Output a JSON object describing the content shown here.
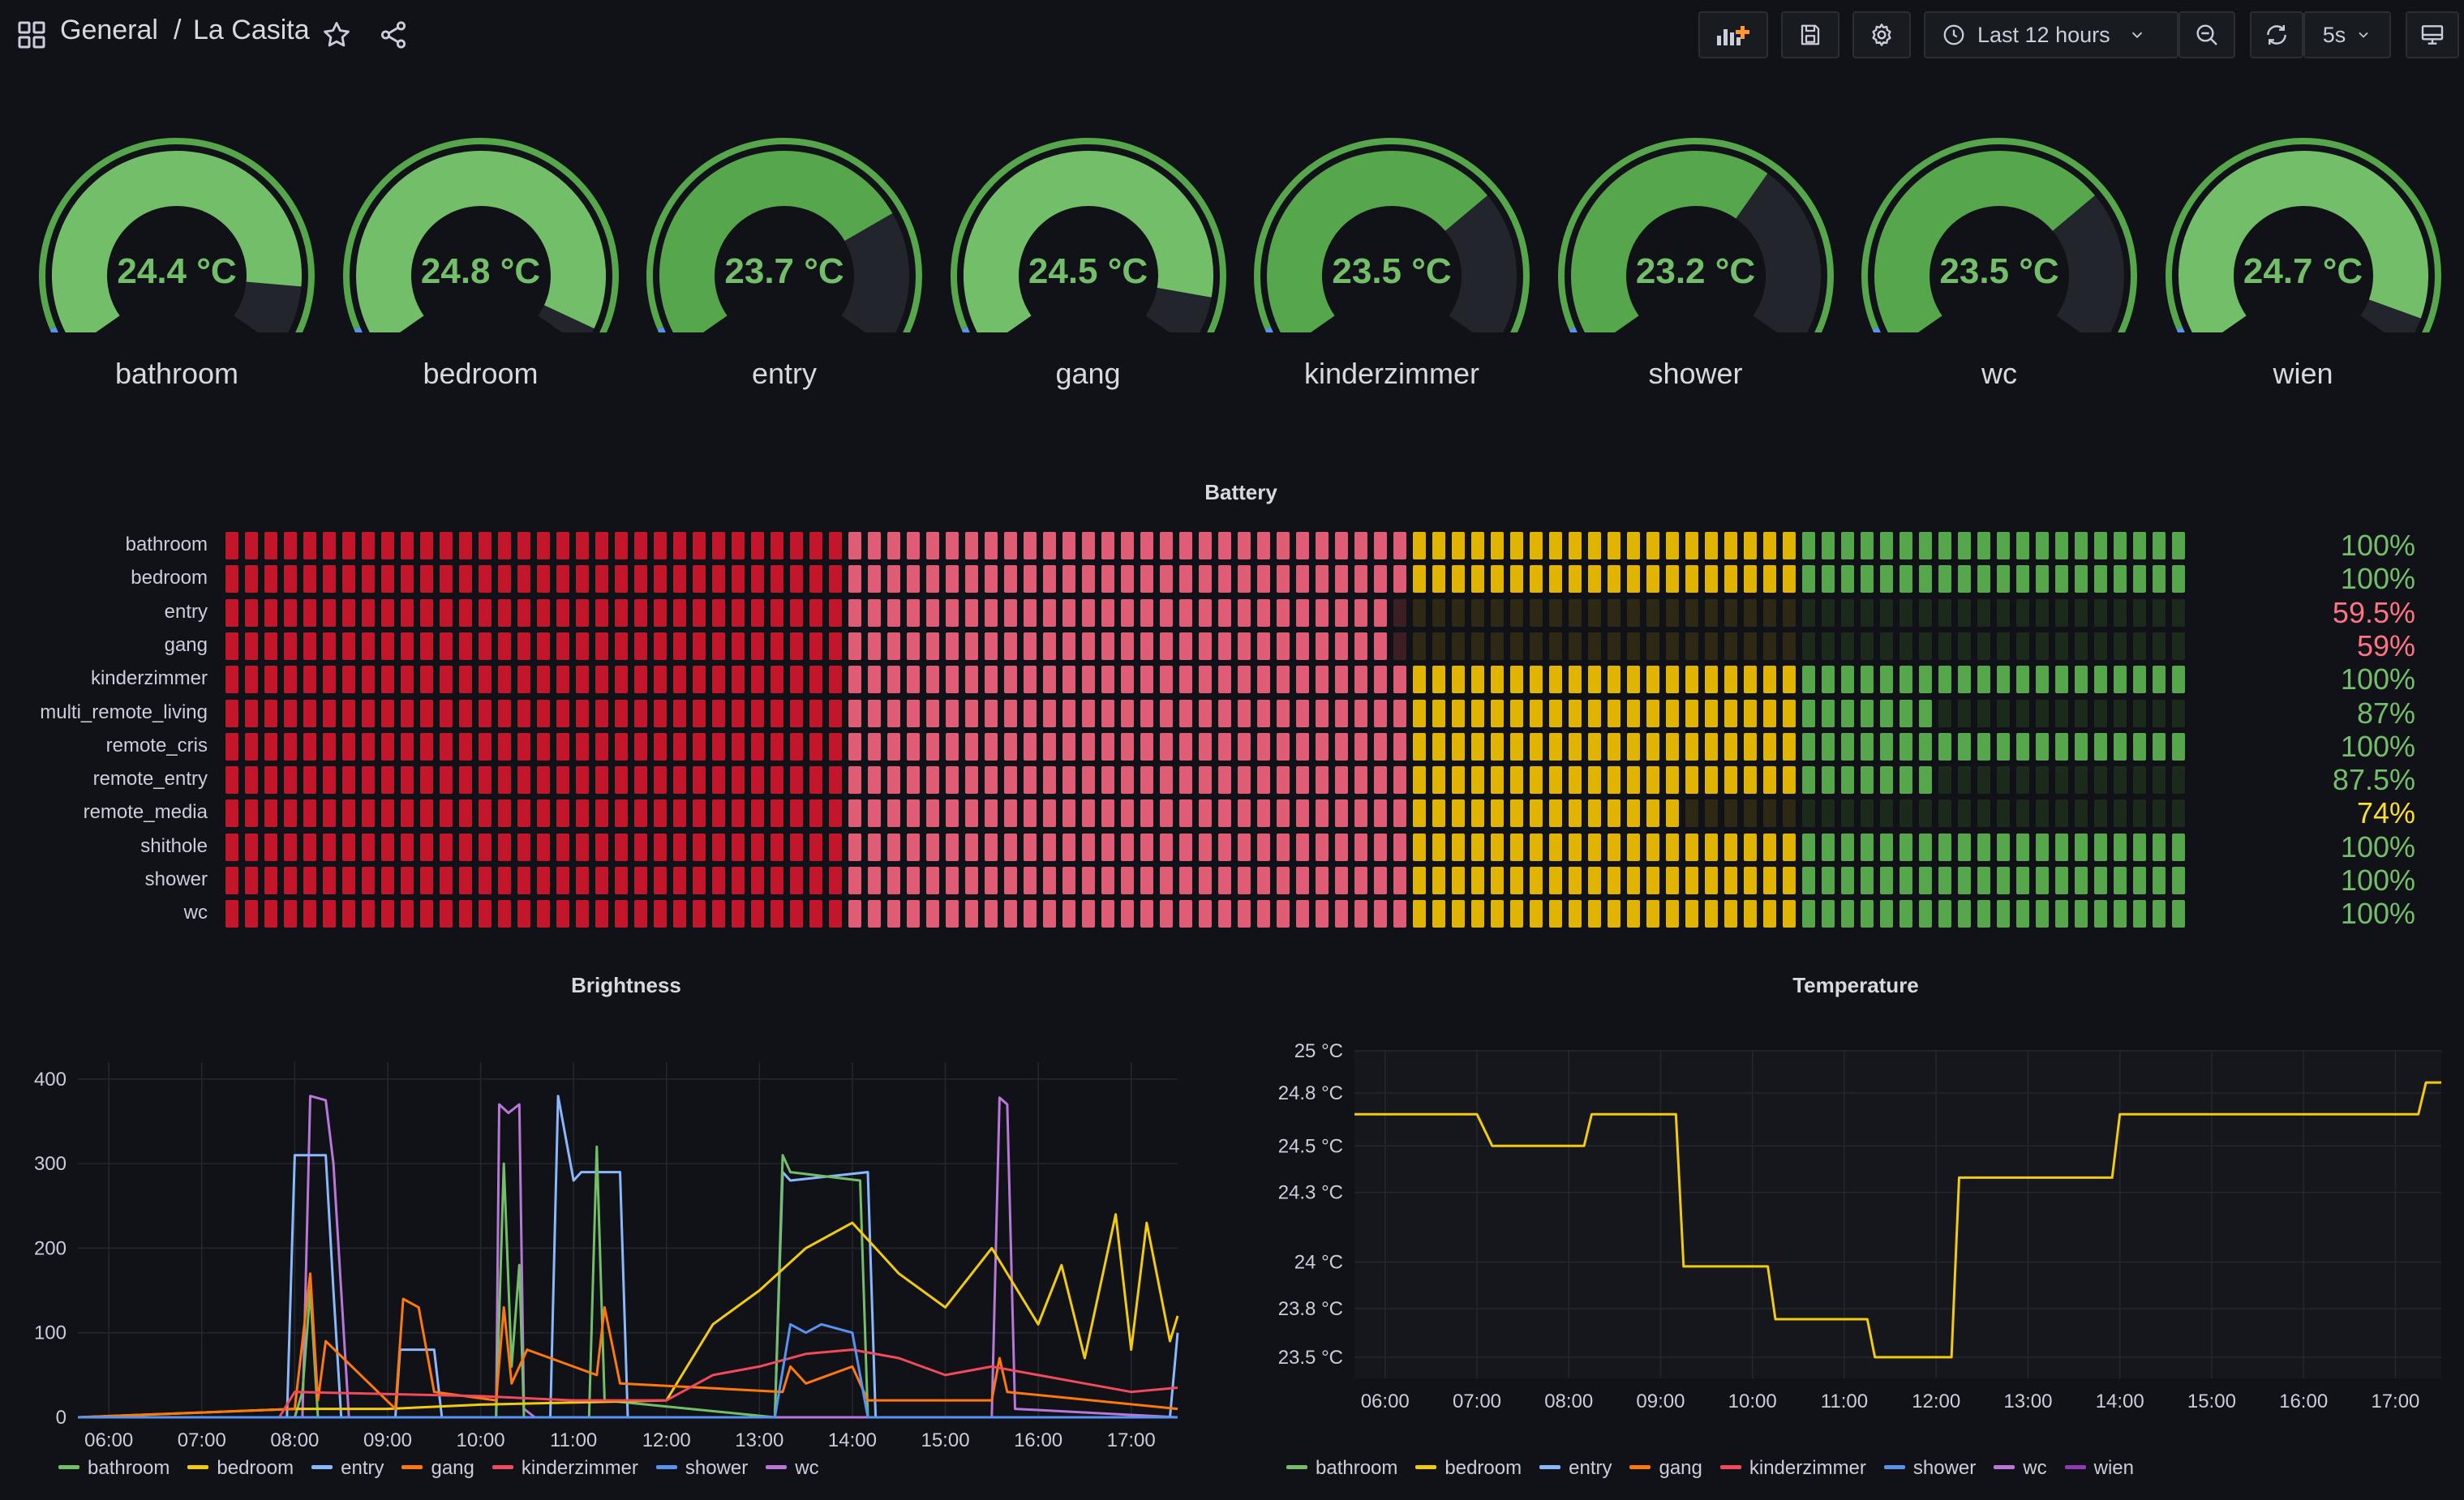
{
  "header": {
    "folder": "General",
    "separator": "/",
    "dashboard": "La Casita",
    "time_range": "Last 12 hours",
    "refresh": "5s"
  },
  "gauges": [
    {
      "name": "bathroom",
      "value": 24.4,
      "display": "24.4 °C"
    },
    {
      "name": "bedroom",
      "value": 24.8,
      "display": "24.8 °C"
    },
    {
      "name": "entry",
      "value": 23.7,
      "display": "23.7 °C"
    },
    {
      "name": "gang",
      "value": 24.5,
      "display": "24.5 °C"
    },
    {
      "name": "kinderzimmer",
      "value": 23.5,
      "display": "23.5 °C"
    },
    {
      "name": "shower",
      "value": 23.2,
      "display": "23.2 °C"
    },
    {
      "name": "wc",
      "value": 23.5,
      "display": "23.5 °C"
    },
    {
      "name": "wien",
      "value": 24.7,
      "display": "24.7 °C"
    }
  ],
  "battery": {
    "title": "Battery",
    "rows": [
      {
        "name": "bathroom",
        "value": 100,
        "display": "100%"
      },
      {
        "name": "bedroom",
        "value": 100,
        "display": "100%"
      },
      {
        "name": "entry",
        "value": 59.5,
        "display": "59.5%"
      },
      {
        "name": "gang",
        "value": 59,
        "display": "59%"
      },
      {
        "name": "kinderzimmer",
        "value": 100,
        "display": "100%"
      },
      {
        "name": "multi_remote_living",
        "value": 87,
        "display": "87%"
      },
      {
        "name": "remote_cris",
        "value": 100,
        "display": "100%"
      },
      {
        "name": "remote_entry",
        "value": 87.5,
        "display": "87.5%"
      },
      {
        "name": "remote_media",
        "value": 74,
        "display": "74%"
      },
      {
        "name": "shithole",
        "value": 100,
        "display": "100%"
      },
      {
        "name": "shower",
        "value": 100,
        "display": "100%"
      },
      {
        "name": "wc",
        "value": 100,
        "display": "100%"
      }
    ]
  },
  "brightness": {
    "title": "Brightness",
    "y_ticks": [
      "400",
      "300",
      "200",
      "100",
      "0"
    ],
    "x_ticks": [
      "06:00",
      "07:00",
      "08:00",
      "09:00",
      "10:00",
      "11:00",
      "12:00",
      "13:00",
      "14:00",
      "15:00",
      "16:00",
      "17:00"
    ],
    "legend": [
      {
        "name": "bathroom",
        "color": "#73bf69"
      },
      {
        "name": "bedroom",
        "color": "#f2cc0c"
      },
      {
        "name": "entry",
        "color": "#8ab8ff"
      },
      {
        "name": "gang",
        "color": "#ff780a"
      },
      {
        "name": "kinderzimmer",
        "color": "#f2495c"
      },
      {
        "name": "shower",
        "color": "#5794f2"
      },
      {
        "name": "wc",
        "color": "#b877d9"
      }
    ]
  },
  "temperature": {
    "title": "Temperature",
    "y_ticks": [
      "25 °C",
      "24.8 °C",
      "24.5 °C",
      "24.3 °C",
      "24 °C",
      "23.8 °C",
      "23.5 °C"
    ],
    "x_ticks": [
      "06:00",
      "07:00",
      "08:00",
      "09:00",
      "10:00",
      "11:00",
      "12:00",
      "13:00",
      "14:00",
      "15:00",
      "16:00",
      "17:00"
    ],
    "legend": [
      {
        "name": "bathroom",
        "color": "#73bf69"
      },
      {
        "name": "bedroom",
        "color": "#f2cc0c"
      },
      {
        "name": "entry",
        "color": "#8ab8ff"
      },
      {
        "name": "gang",
        "color": "#ff780a"
      },
      {
        "name": "kinderzimmer",
        "color": "#f2495c"
      },
      {
        "name": "shower",
        "color": "#5794f2"
      },
      {
        "name": "wc",
        "color": "#b877d9"
      },
      {
        "name": "wien",
        "color": "#8f3bb8"
      }
    ]
  },
  "chart_data": [
    {
      "type": "line",
      "title": "Brightness",
      "ylim": [
        0,
        420
      ],
      "xlim": [
        "05:40",
        "17:30"
      ],
      "series": [
        {
          "name": "wc",
          "x": [
            "05:40",
            "08:05",
            "08:10",
            "08:20",
            "08:25",
            "08:35",
            "09:00",
            "10:10",
            "10:12",
            "10:18",
            "10:25",
            "10:28",
            "10:35",
            "13:20",
            "15:30",
            "15:35",
            "15:40",
            "15:45",
            "17:30"
          ],
          "values": [
            0,
            0,
            380,
            375,
            300,
            0,
            0,
            0,
            370,
            360,
            370,
            10,
            0,
            0,
            0,
            378,
            370,
            10,
            0
          ]
        },
        {
          "name": "entry",
          "x": [
            "05:40",
            "07:55",
            "08:00",
            "08:20",
            "08:25",
            "08:30",
            "09:05",
            "09:08",
            "09:30",
            "09:35",
            "10:45",
            "10:50",
            "11:00",
            "11:05",
            "11:10",
            "11:30",
            "11:35",
            "11:45",
            "13:10",
            "13:15",
            "13:20",
            "14:10",
            "14:15",
            "14:20",
            "17:25",
            "17:30"
          ],
          "values": [
            0,
            0,
            310,
            310,
            150,
            0,
            0,
            80,
            80,
            0,
            0,
            380,
            280,
            290,
            290,
            290,
            0,
            0,
            0,
            290,
            280,
            290,
            0,
            0,
            0,
            100
          ]
        },
        {
          "name": "bathroom",
          "x": [
            "05:40",
            "08:00",
            "08:05",
            "08:10",
            "08:15",
            "10:10",
            "10:15",
            "10:20",
            "10:25",
            "10:28",
            "11:10",
            "11:15",
            "11:20",
            "13:10",
            "13:15",
            "13:20",
            "14:05",
            "14:10",
            "14:15",
            "17:30"
          ],
          "values": [
            0,
            0,
            30,
            150,
            0,
            0,
            300,
            60,
            180,
            0,
            0,
            320,
            20,
            0,
            310,
            290,
            280,
            0,
            0,
            0
          ]
        },
        {
          "name": "bedroom",
          "x": [
            "05:40",
            "08:00",
            "09:00",
            "10:00",
            "12:00",
            "12:30",
            "13:00",
            "13:30",
            "14:00",
            "14:15",
            "14:30",
            "15:00",
            "15:30",
            "16:00",
            "16:15",
            "16:30",
            "16:50",
            "17:00",
            "17:10",
            "17:25",
            "17:30"
          ],
          "values": [
            0,
            10,
            10,
            15,
            20,
            110,
            150,
            200,
            230,
            200,
            170,
            130,
            200,
            110,
            180,
            70,
            240,
            80,
            230,
            90,
            120
          ]
        },
        {
          "name": "gang",
          "x": [
            "05:40",
            "08:00",
            "08:10",
            "08:15",
            "08:20",
            "09:05",
            "09:10",
            "09:20",
            "09:30",
            "10:10",
            "10:15",
            "10:20",
            "10:30",
            "11:15",
            "11:20",
            "11:30",
            "13:15",
            "13:20",
            "13:30",
            "14:00",
            "14:10",
            "15:30",
            "15:35",
            "15:40",
            "17:30"
          ],
          "values": [
            0,
            10,
            170,
            20,
            90,
            10,
            140,
            130,
            30,
            20,
            130,
            40,
            80,
            50,
            130,
            40,
            30,
            60,
            40,
            60,
            20,
            20,
            70,
            30,
            10
          ]
        },
        {
          "name": "kinderzimmer",
          "x": [
            "05:40",
            "07:50",
            "08:00",
            "10:00",
            "11:00",
            "12:00",
            "12:30",
            "13:00",
            "13:30",
            "14:00",
            "14:30",
            "15:00",
            "15:30",
            "16:00",
            "16:30",
            "17:00",
            "17:30"
          ],
          "values": [
            0,
            0,
            30,
            25,
            20,
            20,
            50,
            60,
            75,
            80,
            70,
            50,
            60,
            50,
            40,
            30,
            35
          ]
        },
        {
          "name": "shower",
          "x": [
            "05:40",
            "13:10",
            "13:20",
            "13:30",
            "13:40",
            "14:00",
            "14:10",
            "14:15",
            "17:30"
          ],
          "values": [
            0,
            0,
            110,
            100,
            110,
            100,
            0,
            0,
            0
          ]
        }
      ]
    },
    {
      "type": "line",
      "title": "Temperature",
      "ylim": [
        23.45,
        25.0
      ],
      "xlim": [
        "05:40",
        "17:30"
      ],
      "series": [
        {
          "name": "bedroom",
          "x": [
            "05:40",
            "07:00",
            "07:10",
            "08:10",
            "08:15",
            "09:10",
            "09:15",
            "10:10",
            "10:15",
            "11:15",
            "11:20",
            "12:10",
            "12:15",
            "13:55",
            "14:00",
            "17:15",
            "17:20",
            "17:30"
          ],
          "values": [
            24.7,
            24.7,
            24.55,
            24.55,
            24.7,
            24.7,
            23.98,
            23.98,
            23.73,
            23.73,
            23.55,
            23.55,
            24.4,
            24.4,
            24.7,
            24.7,
            24.85,
            24.85
          ]
        }
      ]
    }
  ]
}
